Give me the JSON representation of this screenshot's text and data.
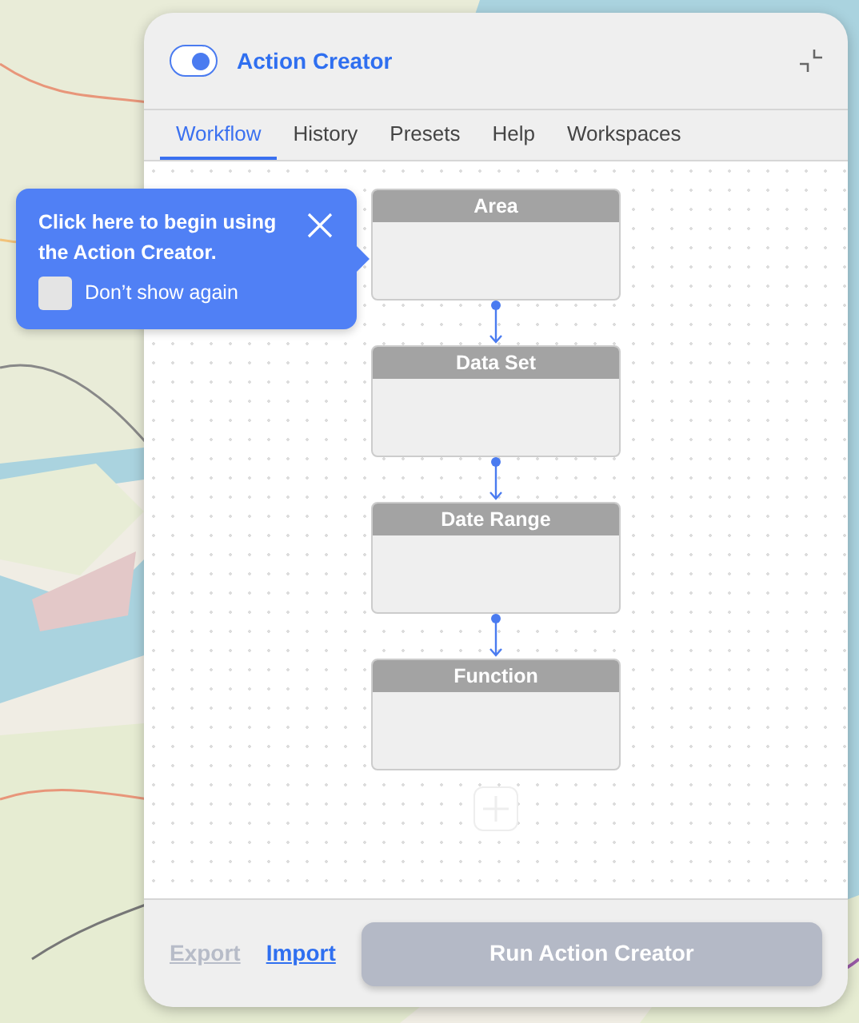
{
  "panel": {
    "title": "Action Creator",
    "toggle_on": true
  },
  "tabs": [
    {
      "label": "Workflow",
      "selected": true
    },
    {
      "label": "History",
      "selected": false
    },
    {
      "label": "Presets",
      "selected": false
    },
    {
      "label": "Help",
      "selected": false
    },
    {
      "label": "Workspaces",
      "selected": false
    }
  ],
  "tooltip": {
    "text": "Click here to begin using the Action Creator.",
    "checkbox_label": "Don’t show again",
    "checked": false
  },
  "nodes": [
    {
      "title": "Area"
    },
    {
      "title": "Data Set"
    },
    {
      "title": "Date Range"
    },
    {
      "title": "Function"
    }
  ],
  "footer": {
    "links": [
      {
        "label": "Export",
        "disabled": true
      },
      {
        "label": "Import",
        "disabled": false
      }
    ],
    "run_button": {
      "label": "Run Action Creator",
      "disabled": true
    }
  }
}
